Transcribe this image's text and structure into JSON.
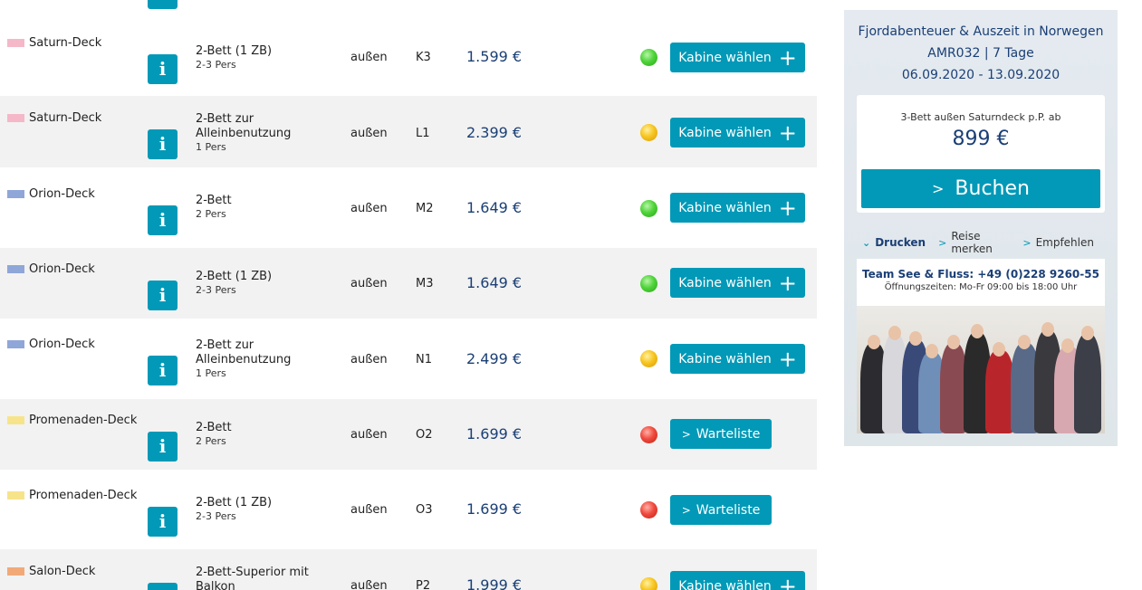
{
  "rows": [
    {
      "deck": "Saturn-Deck",
      "deck_color": "#f4b8c8",
      "type": "2-Bett (1 ZB)",
      "pers": "2-3 Pers",
      "loc": "außen",
      "code": "K3",
      "price": "1.599 €",
      "status": "green",
      "action": "select"
    },
    {
      "deck": "Saturn-Deck",
      "deck_color": "#f4b8c8",
      "type_line1": "2-Bett zur",
      "type_line2": "Alleinbenutzung",
      "pers": "1 Pers",
      "loc": "außen",
      "code": "L1",
      "price": "2.399 €",
      "status": "yellow",
      "action": "select"
    },
    {
      "deck": "Orion-Deck",
      "deck_color": "#8fa6d8",
      "type": "2-Bett",
      "pers": "2 Pers",
      "loc": "außen",
      "code": "M2",
      "price": "1.649 €",
      "status": "green",
      "action": "select"
    },
    {
      "deck": "Orion-Deck",
      "deck_color": "#8fa6d8",
      "type": "2-Bett (1 ZB)",
      "pers": "2-3 Pers",
      "loc": "außen",
      "code": "M3",
      "price": "1.649 €",
      "status": "green",
      "action": "select"
    },
    {
      "deck": "Orion-Deck",
      "deck_color": "#8fa6d8",
      "type_line1": "2-Bett zur",
      "type_line2": "Alleinbenutzung",
      "pers": "1 Pers",
      "loc": "außen",
      "code": "N1",
      "price": "2.499 €",
      "status": "yellow",
      "action": "select"
    },
    {
      "deck": "Promenaden-Deck",
      "deck_color": "#f7e48a",
      "type": "2-Bett",
      "pers": "2 Pers",
      "loc": "außen",
      "code": "O2",
      "price": "1.699 €",
      "status": "red",
      "action": "wait"
    },
    {
      "deck": "Promenaden-Deck",
      "deck_color": "#f7e48a",
      "type": "2-Bett (1 ZB)",
      "pers": "2-3 Pers",
      "loc": "außen",
      "code": "O3",
      "price": "1.699 €",
      "status": "red",
      "action": "wait"
    },
    {
      "deck": "Salon-Deck",
      "deck_color": "#f2a978",
      "type_line1": "2-Bett-Superior mit",
      "type_line2": "Balkon",
      "loc": "außen",
      "code": "P2",
      "price": "1.999 €",
      "status": "yellow",
      "action": "select"
    }
  ],
  "buttons": {
    "select_label": "Kabine wählen",
    "wait_label": "Warteliste",
    "info_glyph": "i"
  },
  "sidebar": {
    "title_line1": "Fjordabenteuer & Auszeit in Norwegen",
    "title_line2": "AMR032 | 7 Tage",
    "title_line3": "06.09.2020 - 13.09.2020",
    "price_label": "3-Bett außen Saturndeck p.P. ab",
    "price": "899 €",
    "book_label": "Buchen",
    "actions": {
      "print": "Drucken",
      "remember": "Reise merken",
      "recommend": "Empfehlen"
    },
    "team_prefix": "Team See & Fluss:",
    "team_phone": "+49 (0)228 9260-55",
    "hours": "Öffnungszeiten: Mo-Fr 09:00 bis 18:00 Uhr"
  },
  "colors": {
    "accent": "#0199b7",
    "price_text": "#1b3f75",
    "row_alt": "#f2f2f2"
  }
}
